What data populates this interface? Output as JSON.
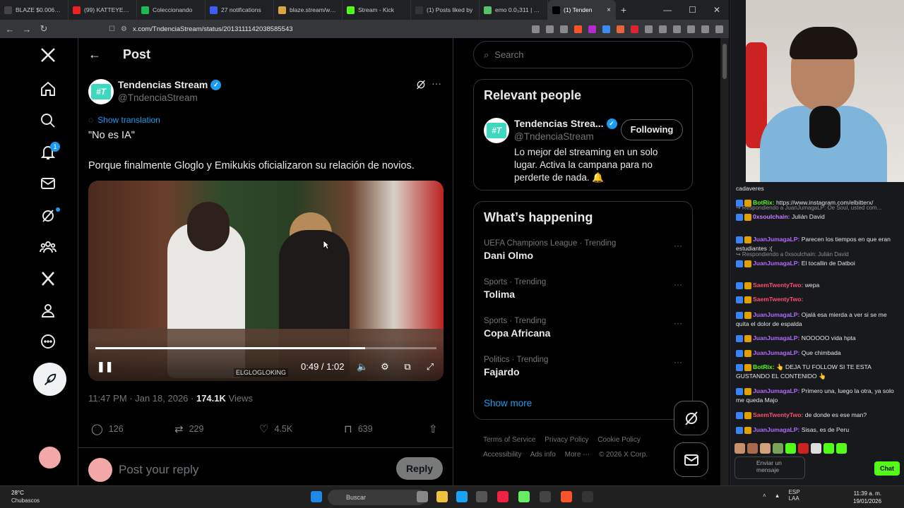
{
  "browser": {
    "tabs": [
      {
        "title": "BLAZE $0.006317",
        "color": "#444"
      },
      {
        "title": "(99) KATTEYES TIE",
        "color": "#e22"
      },
      {
        "title": "Coleccionando",
        "color": "#1db954"
      },
      {
        "title": "27 notifications",
        "color": "#3b5cf6"
      },
      {
        "title": "blaze.stream/walle",
        "color": "#d9a441"
      },
      {
        "title": "Stream - Kick",
        "color": "#53fc18"
      },
      {
        "title": "(1) Posts liked by",
        "color": "#333"
      },
      {
        "title": "emo 0.0₃311 | GM",
        "color": "#58c16b"
      },
      {
        "title": "(1) Tenden",
        "color": "#000"
      }
    ],
    "new_tab": "+",
    "url": "x.com/TndenciaStream/status/2013111142038585543"
  },
  "nav": {
    "notif_count": "1"
  },
  "post": {
    "header_title": "Post",
    "author_name": "Tendencias Stream",
    "author_handle": "@TndenciaStream",
    "avatar_text": "#T",
    "show_translation": "Show translation",
    "line1": "\"No es IA\"",
    "line2": "Porque finalmente Gloglo y Emikukis oficializaron su relación de novios.",
    "video": {
      "time": "0:49 / 1:02",
      "progress": 0.79,
      "watermark": "ELGLOGLOKING"
    },
    "timestamp": "11:47 PM · Jan 18, 2026 · ",
    "views_count": "174.1K",
    "views_label": " Views",
    "replies": "126",
    "reposts": "229",
    "likes": "4.5K",
    "bookmarks": "639",
    "reply_placeholder": "Post your reply",
    "reply_button": "Reply"
  },
  "sidebar": {
    "search_placeholder": "Search",
    "relevant_title": "Relevant people",
    "rel_name": "Tendencias Strea...",
    "rel_handle": "@TndenciaStream",
    "rel_follow": "Following",
    "rel_bio": "Lo mejor del streaming en un solo lugar. Activa la campana para no perderte de nada. 🔔",
    "happening_title": "What’s happening",
    "trends": [
      {
        "category": "UEFA Champions League · Trending",
        "name": "Dani Olmo"
      },
      {
        "category": "Sports · Trending",
        "name": "Tolima"
      },
      {
        "category": "Sports · Trending",
        "name": "Copa Africana"
      },
      {
        "category": "Politics · Trending",
        "name": "Fajardo"
      }
    ],
    "show_more": "Show more",
    "footer": {
      "terms": "Terms of Service",
      "privacy": "Privacy Policy",
      "cookie": "Cookie Policy",
      "accessibility": "Accessibility",
      "ads": "Ads info",
      "more": "More ···",
      "copyright": "© 2026 X Corp."
    }
  },
  "chat": {
    "messages": [
      {
        "reply": "",
        "user": "",
        "user_color": "#aaa",
        "text": "cadaveres"
      },
      {
        "reply": "",
        "user": "BotRix:",
        "user_color": "#53fc18",
        "text": "https://www.instagram.com/elbitterx/"
      },
      {
        "reply": "↪ Respondiendo a JuanJumagaLP: Oe Soul, usted com...",
        "user": "0xsoulchain:",
        "user_color": "#c780ff",
        "text": "Julián David"
      },
      {
        "reply": "",
        "user": "JuanJumagaLP:",
        "user_color": "#b36bff",
        "text": "Parecen los tiempos en que eran estudiantes :("
      },
      {
        "reply": "↪ Respondiendo a 0xsoulchain: Julián David",
        "user": "JuanJumagaLP:",
        "user_color": "#b36bff",
        "text": "El tocallin de Datboi"
      },
      {
        "reply": "",
        "user": "SaemTwentyTwo:",
        "user_color": "#ff4d6d",
        "text": "wepa"
      },
      {
        "reply": "",
        "user": "SaemTwentyTwo:",
        "user_color": "#ff4d6d",
        "text": ""
      },
      {
        "reply": "",
        "user": "JuanJumagaLP:",
        "user_color": "#b36bff",
        "text": "Ojalá esa mierda a ver si se me quita el dolor de espalda"
      },
      {
        "reply": "",
        "user": "JuanJumagaLP:",
        "user_color": "#b36bff",
        "text": "NOOOOO vida hpta"
      },
      {
        "reply": "",
        "user": "JuanJumagaLP:",
        "user_color": "#b36bff",
        "text": "Que chimbada"
      },
      {
        "reply": "",
        "user": "BotRix:",
        "user_color": "#53fc18",
        "text": "👆 DEJA TU FOLLOW SI TE ESTA GUSTANDO EL CONTENIDO 👆"
      },
      {
        "reply": "",
        "user": "JuanJumagaLP:",
        "user_color": "#b36bff",
        "text": "Primero una, luego la otra, ya solo me queda Majo"
      },
      {
        "reply": "",
        "user": "SaemTwentyTwo:",
        "user_color": "#ff4d6d",
        "text": "de donde es ese man?"
      },
      {
        "reply": "",
        "user": "JuanJumagaLP:",
        "user_color": "#b36bff",
        "text": "Sisas, es de Peru"
      }
    ],
    "input_placeholder": "Enviar un mensaje",
    "send_button": "Chat"
  },
  "taskbar": {
    "temp": "28°C",
    "condition": "Chubascos",
    "search_placeholder": "Buscar",
    "lang": "ESP",
    "lang2": "LAA",
    "time": "11:39 a. m.",
    "date": "19/01/2026"
  }
}
